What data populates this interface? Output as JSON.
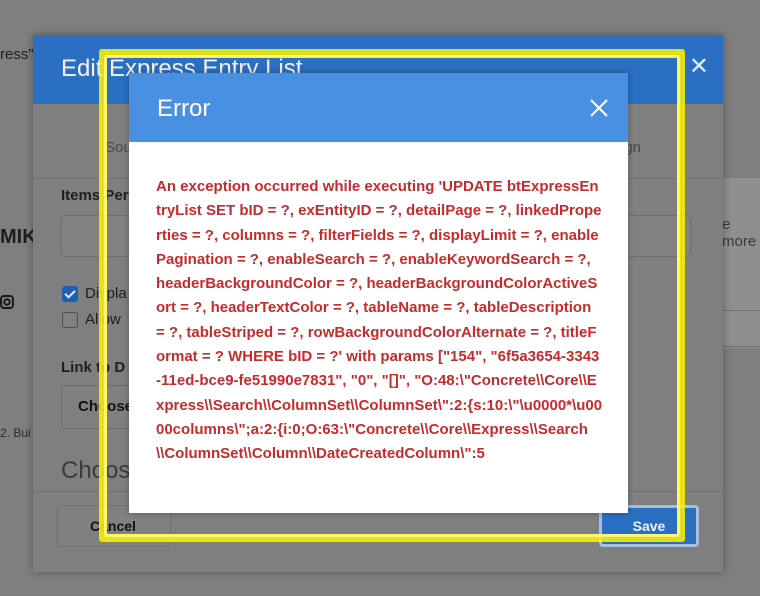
{
  "background": {
    "top_left_fragment": "ress\")",
    "left_brand_fragment": "MIK",
    "right_fragment": "e more",
    "footer_fragment": "2. Bui"
  },
  "modal": {
    "title": "Edit Express Entry List",
    "tab_left": "Sou",
    "tab_right": "ign",
    "items_per_label": "Items Per",
    "display_label": "Displa",
    "allow_label": "Allow",
    "display_checked": true,
    "allow_checked": false,
    "link_label": "Link to D",
    "select_button": "Choose",
    "choose_heading": "Choos",
    "cancel_button": "Cancel",
    "save_button": "Save"
  },
  "error": {
    "title": "Error",
    "message": "An exception occurred while executing 'UPDATE btExpressEntryList SET bID = ?, exEntityID = ?, detailPage = ?, linkedProperties = ?, columns = ?, filterFields = ?, displayLimit = ?, enablePagination = ?, enableSearch = ?, enableKeywordSearch = ?, headerBackgroundColor = ?, headerBackgroundColorActiveSort = ?, headerTextColor = ?, tableName = ?, tableDescription = ?, tableStriped = ?, rowBackgroundColorAlternate = ?, titleFormat = ? WHERE bID = ?' with params [\"154\", \"6f5a3654-3343-11ed-bce9-fe51990e7831\", \"0\", \"[]\", \"O:48:\\\"Concrete\\\\Core\\\\Express\\\\Search\\\\ColumnSet\\\\ColumnSet\\\":2:{s:10:\\\"\\u0000*\\u0000columns\\\";a:2:{i:0;O:63:\\\"Concrete\\\\Core\\\\Express\\\\Search\\\\ColumnSet\\\\Column\\\\DateCreatedColumn\\\":5"
  },
  "colors": {
    "error_header": "#4a90e2",
    "error_text": "#c62b2b",
    "highlight": "#fff200"
  }
}
